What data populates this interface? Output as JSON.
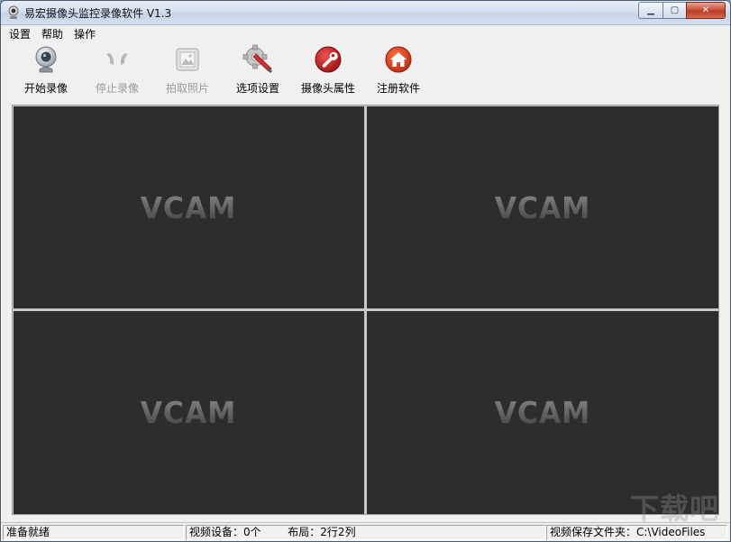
{
  "window": {
    "title": "易宏摄像头监控录像软件 V1.3",
    "min_glyph": "▁",
    "max_glyph": "▢",
    "close_glyph": "✕"
  },
  "menu": {
    "items": [
      "设置",
      "帮助",
      "操作"
    ]
  },
  "toolbar": {
    "items": [
      {
        "label": "开始录像",
        "icon": "webcam-icon",
        "enabled": true
      },
      {
        "label": "停止录像",
        "icon": "stop-record-icon",
        "enabled": false
      },
      {
        "label": "拍取照片",
        "icon": "photo-icon",
        "enabled": false
      },
      {
        "label": "选项设置",
        "icon": "gear-brush-icon",
        "enabled": true
      },
      {
        "label": "摄像头属性",
        "icon": "wrench-icon",
        "enabled": true
      },
      {
        "label": "注册软件",
        "icon": "home-icon",
        "enabled": true
      }
    ]
  },
  "video": {
    "panes": [
      {
        "logo": "VCAM"
      },
      {
        "logo": "VCAM"
      },
      {
        "logo": "VCAM"
      },
      {
        "logo": "VCAM"
      }
    ]
  },
  "status": {
    "ready": "准备就绪",
    "devices": "视频设备：0个",
    "layout": "布局：2行2列",
    "folder": "视频保存文件夹：C:\\VideoFiles"
  },
  "watermark": "下载吧",
  "colors": {
    "pane_bg": "#2d2d2d",
    "wrench_red": "#c62828",
    "home_red": "#d84315"
  }
}
